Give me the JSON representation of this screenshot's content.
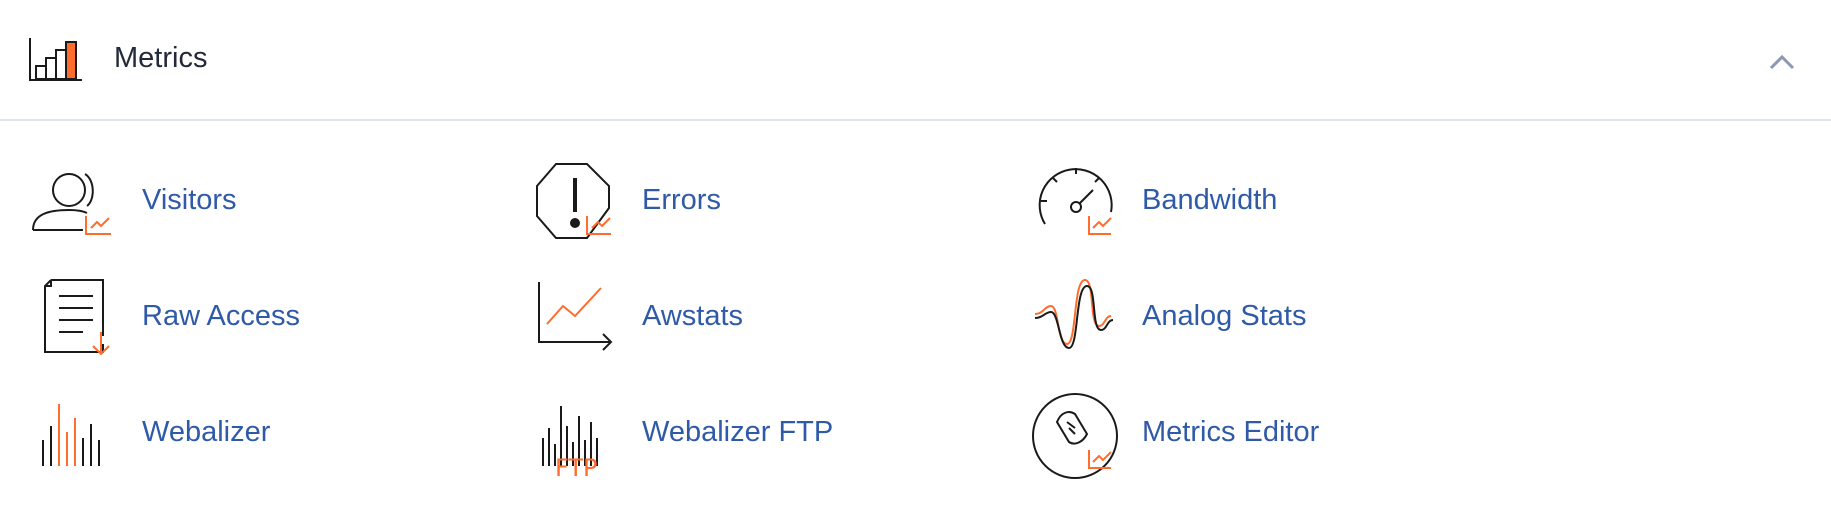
{
  "panel": {
    "title": "Metrics",
    "icons": {
      "header": "metrics-bar-chart-icon",
      "collapse": "chevron-up-icon"
    },
    "colors": {
      "accent": "#ff6c2c",
      "link": "#2f5aa8",
      "title": "#22293a",
      "line": "#1a1a1a",
      "divider": "#dfe3ee"
    }
  },
  "items": [
    {
      "label": "Visitors",
      "icon": "visitors-icon"
    },
    {
      "label": "Errors",
      "icon": "errors-icon"
    },
    {
      "label": "Bandwidth",
      "icon": "bandwidth-gauge-icon"
    },
    {
      "label": "Raw Access",
      "icon": "raw-access-document-icon"
    },
    {
      "label": "Awstats",
      "icon": "awstats-line-chart-icon"
    },
    {
      "label": "Analog Stats",
      "icon": "analog-stats-wave-icon"
    },
    {
      "label": "Webalizer",
      "icon": "webalizer-bars-icon"
    },
    {
      "label": "Webalizer FTP",
      "icon": "webalizer-ftp-icon",
      "icon_text": "FTP"
    },
    {
      "label": "Metrics Editor",
      "icon": "metrics-editor-icon"
    }
  ]
}
